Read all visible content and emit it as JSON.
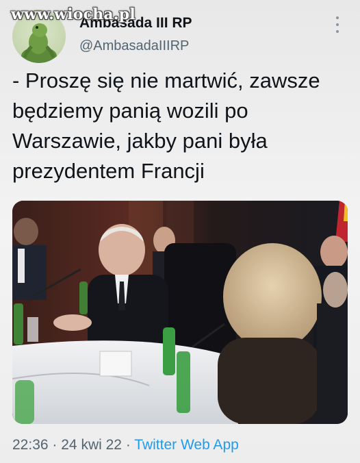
{
  "watermark": "www.wiocha.pl",
  "tweet": {
    "author_name": "Ambasada III RP",
    "author_handle": "@AmbasadaIIIRP",
    "text": "- Proszę się nie martwić, zawsze będziemy panią wozili po Warszawie, jakby pani była prezydentem Francji",
    "more_icon": "more-vertical-icon",
    "media_description_visible": false,
    "time": "22:36",
    "separator": "·",
    "date": "24 kwi 22",
    "source_app": "Twitter Web App"
  },
  "colors": {
    "text_primary": "#0f1419",
    "text_secondary": "#536471",
    "link": "#1d9bf0"
  }
}
